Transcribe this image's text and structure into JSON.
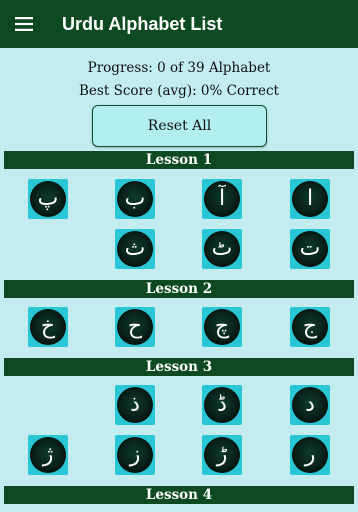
{
  "app": {
    "title": "Urdu Alphabet List",
    "colors": {
      "appbar": "#0d4a21",
      "background": "#c2ecef",
      "tile": "#29c7d6",
      "disc": "#071a14",
      "lesson_bar": "#0d4a21"
    }
  },
  "stats": {
    "progress": "Progress:  0 of 39 Alphabet",
    "best_score": "Best Score (avg):    0% Correct"
  },
  "actions": {
    "reset_label": "Reset All"
  },
  "lessons": [
    {
      "title": "Lesson 1",
      "letters": [
        "پ",
        "ب",
        "آ",
        "ا",
        "ث",
        "ٹ",
        "ت"
      ]
    },
    {
      "title": "Lesson 2",
      "letters": [
        "خ",
        "ح",
        "چ",
        "ج"
      ]
    },
    {
      "title": "Lesson 3",
      "letters": [
        "ذ",
        "ڈ",
        "د",
        "ژ",
        "ز",
        "ڑ",
        "ر"
      ]
    },
    {
      "title": "Lesson 4",
      "letters": []
    }
  ]
}
